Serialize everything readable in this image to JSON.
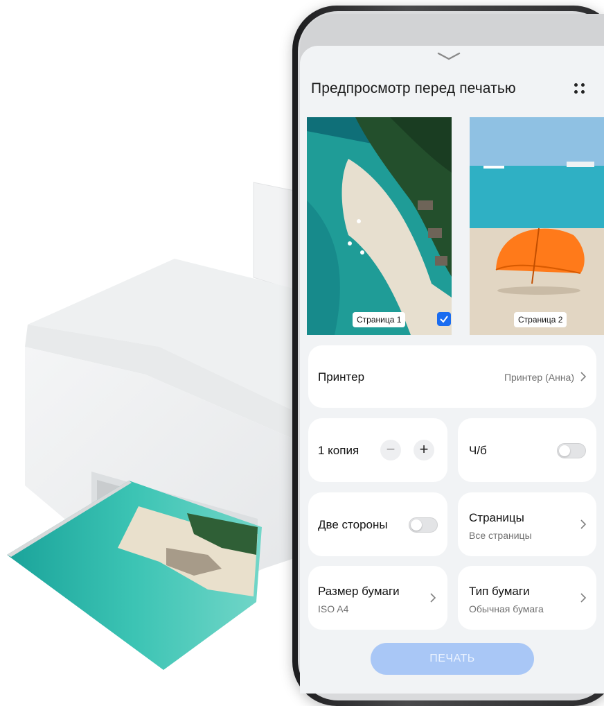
{
  "screen": {
    "title": "Предпросмотр перед печатью",
    "icons": {
      "handle": "chevron-down-icon",
      "more": "more-dots-icon",
      "chevron": "chevron-right-icon",
      "check": "checkmark-icon"
    },
    "pages": [
      {
        "label": "Страница 1",
        "selected": true
      },
      {
        "label": "Страница 2",
        "selected": true
      }
    ],
    "printer": {
      "label": "Принтер",
      "value": "Принтер (Анна)"
    },
    "copies": {
      "label": "1 копия",
      "minus": "−",
      "plus": "+"
    },
    "bw": {
      "label": "Ч/б",
      "enabled": false
    },
    "duplex": {
      "label": "Две стороны",
      "enabled": false
    },
    "pages_setting": {
      "label": "Страницы",
      "value": "Все страницы"
    },
    "paper_size": {
      "label": "Размер бумаги",
      "value": "ISO A4"
    },
    "paper_type": {
      "label": "Тип бумаги",
      "value": "Обычная бумага"
    },
    "print_button": "ПЕЧАТЬ"
  },
  "colors": {
    "accent": "#1a6cf0",
    "print_button_bg": "#a9c7f6",
    "screen_bg": "#f1f3f5"
  }
}
